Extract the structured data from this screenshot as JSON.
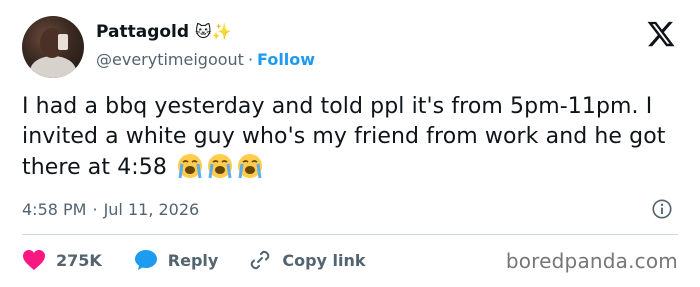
{
  "user": {
    "display_name": "Pattagold",
    "name_emojis": "🐱✨",
    "handle": "@everytimeigoout",
    "separator": "·",
    "follow_label": "Follow"
  },
  "tweet": {
    "text": "I had a bbq yesterday and told ppl it's from 5pm-11pm. I invited a white guy who's my friend from work and he got there at 4:58",
    "emojis": [
      "loudly-crying-face",
      "loudly-crying-face",
      "loudly-crying-face"
    ]
  },
  "meta": {
    "time": "4:58 PM",
    "separator": "·",
    "date": "Jul 11, 2026"
  },
  "actions": {
    "likes": "275K",
    "reply_label": "Reply",
    "copy_link_label": "Copy link"
  },
  "watermark": "boredpanda.com",
  "colors": {
    "accent": "#1d9bf0",
    "like": "#f91880",
    "text": "#0f1419",
    "secondary": "#536471",
    "divider": "#cfd9de"
  }
}
